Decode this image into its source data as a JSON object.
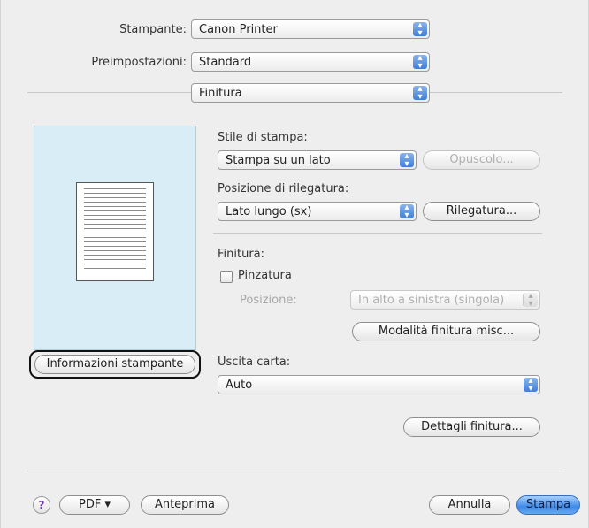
{
  "printer": {
    "label": "Stampante:",
    "value": "Canon Printer"
  },
  "presets": {
    "label": "Preimpostazioni:",
    "value": "Standard"
  },
  "panel_select": {
    "value": "Finitura"
  },
  "print_style": {
    "label": "Stile di stampa:",
    "value": "Stampa su un lato",
    "booklet_button": "Opuscolo..."
  },
  "binding_location": {
    "label": "Posizione di rilegatura:",
    "value": "Lato lungo (sx)",
    "binding_button": "Rilegatura..."
  },
  "finishing": {
    "label": "Finitura:",
    "staple_label": "Pinzatura",
    "staple_checked": false,
    "position_label": "Posizione:",
    "position_value": "In alto a sinistra (singola)",
    "misc_button": "Modalità finitura misc..."
  },
  "printer_info_button": "Informazioni stampante",
  "paper_output": {
    "label": "Uscita carta:",
    "value": "Auto"
  },
  "finishing_details_button": "Dettagli finitura...",
  "footer": {
    "help": "?",
    "pdf_button": "PDF ▾",
    "preview_button": "Anteprima",
    "cancel_button": "Annulla",
    "print_button": "Stampa"
  },
  "colors": {
    "accent": "#3f7ed6",
    "preview_bg": "#d9edf7"
  },
  "icons": {
    "popup_arrows": "up-down-arrows-icon",
    "help": "question-mark-icon",
    "page": "document-page-icon"
  }
}
